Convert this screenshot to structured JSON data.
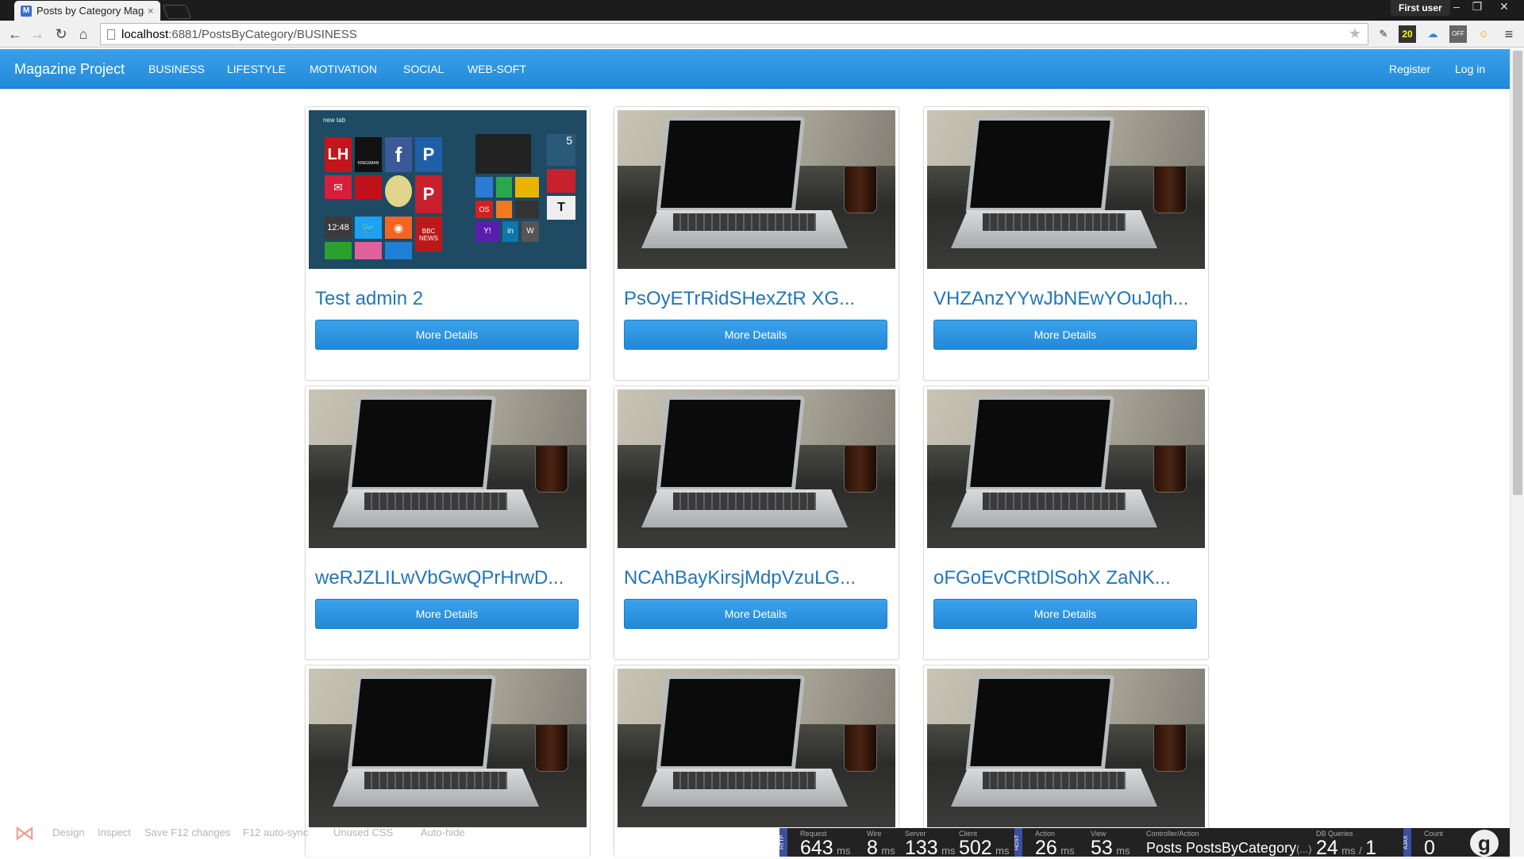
{
  "browser": {
    "tab_title": "Posts by Category Magaz",
    "tab_favicon": "M",
    "tab_close": "×",
    "user_badge": "First user",
    "url_host": "localhost",
    "url_rest": ":6881/PostsByCategory/BUSINESS",
    "ext_counter": "20",
    "ext_off": "OFF"
  },
  "navbar": {
    "brand": "Magazine Project",
    "links": [
      "BUSINESS",
      "LIFESTYLE",
      "MOTIVATION",
      "SOCIAL",
      "WEB-SOFT"
    ],
    "right_links": [
      "Register",
      "Log in"
    ]
  },
  "posts": [
    {
      "title": "Test admin 2",
      "button": "More Details",
      "image": "windows8-start-screen"
    },
    {
      "title": "PsOyETrRidSHexZtR XG...",
      "button": "More Details",
      "image": "laptop-photo"
    },
    {
      "title": "VHZAnzYYwJbNEwYOuJqh...",
      "button": "More Details",
      "image": "laptop-photo"
    },
    {
      "title": "weRJZLILwVbGwQPrHrwD...",
      "button": "More Details",
      "image": "laptop-photo"
    },
    {
      "title": "NCAhBayKirsjMdpVzuLG...",
      "button": "More Details",
      "image": "laptop-photo"
    },
    {
      "title": "oFGoEvCRtDlSohX ZaNK...",
      "button": "More Details",
      "image": "laptop-photo"
    },
    {
      "title": "",
      "button": "",
      "image": "laptop-photo"
    },
    {
      "title": "",
      "button": "",
      "image": "laptop-photo"
    },
    {
      "title": "",
      "button": "",
      "image": "laptop-photo"
    }
  ],
  "win8_tile_text": {
    "new_tab": "new tab",
    "lh": "LH",
    "kingsman": "KINGSMAN",
    "clock": "12:48",
    "bbc": "BBC NEWS",
    "yahoo": "Y!",
    "linkedin": "in",
    "wiki": "W",
    "number": "5",
    "os": "OS",
    "nyt": "T"
  },
  "devbar": {
    "items": [
      "Design",
      "Inspect",
      "Save F12 changes",
      "F12 auto-sync",
      "Unused CSS",
      "Auto-hide"
    ]
  },
  "glimpse": {
    "request": {
      "label": "Request",
      "value": "643",
      "unit": "ms"
    },
    "wire": {
      "label": "Wire",
      "value": "8",
      "unit": "ms"
    },
    "server": {
      "label": "Server",
      "value": "133",
      "unit": "ms"
    },
    "client": {
      "label": "Client",
      "value": "502",
      "unit": "ms"
    },
    "action": {
      "label": "Action",
      "value": "26",
      "unit": "ms"
    },
    "view": {
      "label": "View",
      "value": "53",
      "unit": "ms"
    },
    "controller": {
      "label": "Controller/Action",
      "value": "Posts PostsByCategory",
      "suffix": "(...)"
    },
    "db": {
      "label": "DB Queries",
      "value": "24",
      "unit": "ms",
      "count": "1"
    },
    "ajax": {
      "label": "Count",
      "value": "0"
    },
    "tags": {
      "http": "HTTP",
      "host": "HOST",
      "ajax": "AJAX"
    }
  }
}
